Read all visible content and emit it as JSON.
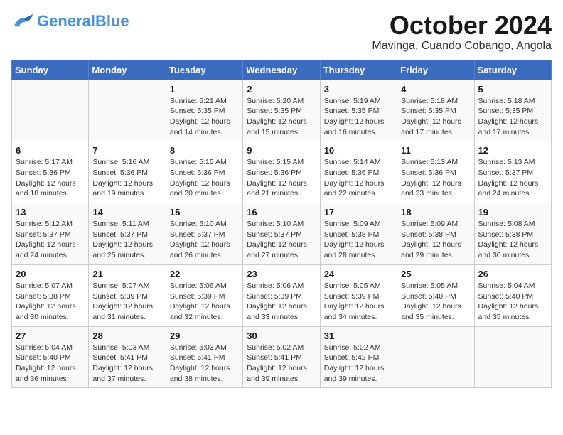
{
  "header": {
    "logo_general": "General",
    "logo_blue": "Blue",
    "month_title": "October 2024",
    "location": "Mavinga, Cuando Cobango, Angola"
  },
  "days_of_week": [
    "Sunday",
    "Monday",
    "Tuesday",
    "Wednesday",
    "Thursday",
    "Friday",
    "Saturday"
  ],
  "weeks": [
    [
      {
        "day": "",
        "info": ""
      },
      {
        "day": "",
        "info": ""
      },
      {
        "day": "1",
        "info": "Sunrise: 5:21 AM\nSunset: 5:35 PM\nDaylight: 12 hours and 14 minutes."
      },
      {
        "day": "2",
        "info": "Sunrise: 5:20 AM\nSunset: 5:35 PM\nDaylight: 12 hours and 15 minutes."
      },
      {
        "day": "3",
        "info": "Sunrise: 5:19 AM\nSunset: 5:35 PM\nDaylight: 12 hours and 16 minutes."
      },
      {
        "day": "4",
        "info": "Sunrise: 5:18 AM\nSunset: 5:35 PM\nDaylight: 12 hours and 17 minutes."
      },
      {
        "day": "5",
        "info": "Sunrise: 5:18 AM\nSunset: 5:35 PM\nDaylight: 12 hours and 17 minutes."
      }
    ],
    [
      {
        "day": "6",
        "info": "Sunrise: 5:17 AM\nSunset: 5:36 PM\nDaylight: 12 hours and 18 minutes."
      },
      {
        "day": "7",
        "info": "Sunrise: 5:16 AM\nSunset: 5:36 PM\nDaylight: 12 hours and 19 minutes."
      },
      {
        "day": "8",
        "info": "Sunrise: 5:15 AM\nSunset: 5:36 PM\nDaylight: 12 hours and 20 minutes."
      },
      {
        "day": "9",
        "info": "Sunrise: 5:15 AM\nSunset: 5:36 PM\nDaylight: 12 hours and 21 minutes."
      },
      {
        "day": "10",
        "info": "Sunrise: 5:14 AM\nSunset: 5:36 PM\nDaylight: 12 hours and 22 minutes."
      },
      {
        "day": "11",
        "info": "Sunrise: 5:13 AM\nSunset: 5:36 PM\nDaylight: 12 hours and 23 minutes."
      },
      {
        "day": "12",
        "info": "Sunrise: 5:13 AM\nSunset: 5:37 PM\nDaylight: 12 hours and 24 minutes."
      }
    ],
    [
      {
        "day": "13",
        "info": "Sunrise: 5:12 AM\nSunset: 5:37 PM\nDaylight: 12 hours and 24 minutes."
      },
      {
        "day": "14",
        "info": "Sunrise: 5:11 AM\nSunset: 5:37 PM\nDaylight: 12 hours and 25 minutes."
      },
      {
        "day": "15",
        "info": "Sunrise: 5:10 AM\nSunset: 5:37 PM\nDaylight: 12 hours and 26 minutes."
      },
      {
        "day": "16",
        "info": "Sunrise: 5:10 AM\nSunset: 5:37 PM\nDaylight: 12 hours and 27 minutes."
      },
      {
        "day": "17",
        "info": "Sunrise: 5:09 AM\nSunset: 5:38 PM\nDaylight: 12 hours and 28 minutes."
      },
      {
        "day": "18",
        "info": "Sunrise: 5:09 AM\nSunset: 5:38 PM\nDaylight: 12 hours and 29 minutes."
      },
      {
        "day": "19",
        "info": "Sunrise: 5:08 AM\nSunset: 5:38 PM\nDaylight: 12 hours and 30 minutes."
      }
    ],
    [
      {
        "day": "20",
        "info": "Sunrise: 5:07 AM\nSunset: 5:38 PM\nDaylight: 12 hours and 30 minutes."
      },
      {
        "day": "21",
        "info": "Sunrise: 5:07 AM\nSunset: 5:39 PM\nDaylight: 12 hours and 31 minutes."
      },
      {
        "day": "22",
        "info": "Sunrise: 5:06 AM\nSunset: 5:39 PM\nDaylight: 12 hours and 32 minutes."
      },
      {
        "day": "23",
        "info": "Sunrise: 5:06 AM\nSunset: 5:39 PM\nDaylight: 12 hours and 33 minutes."
      },
      {
        "day": "24",
        "info": "Sunrise: 5:05 AM\nSunset: 5:39 PM\nDaylight: 12 hours and 34 minutes."
      },
      {
        "day": "25",
        "info": "Sunrise: 5:05 AM\nSunset: 5:40 PM\nDaylight: 12 hours and 35 minutes."
      },
      {
        "day": "26",
        "info": "Sunrise: 5:04 AM\nSunset: 5:40 PM\nDaylight: 12 hours and 35 minutes."
      }
    ],
    [
      {
        "day": "27",
        "info": "Sunrise: 5:04 AM\nSunset: 5:40 PM\nDaylight: 12 hours and 36 minutes."
      },
      {
        "day": "28",
        "info": "Sunrise: 5:03 AM\nSunset: 5:41 PM\nDaylight: 12 hours and 37 minutes."
      },
      {
        "day": "29",
        "info": "Sunrise: 5:03 AM\nSunset: 5:41 PM\nDaylight: 12 hours and 38 minutes."
      },
      {
        "day": "30",
        "info": "Sunrise: 5:02 AM\nSunset: 5:41 PM\nDaylight: 12 hours and 39 minutes."
      },
      {
        "day": "31",
        "info": "Sunrise: 5:02 AM\nSunset: 5:42 PM\nDaylight: 12 hours and 39 minutes."
      },
      {
        "day": "",
        "info": ""
      },
      {
        "day": "",
        "info": ""
      }
    ]
  ]
}
